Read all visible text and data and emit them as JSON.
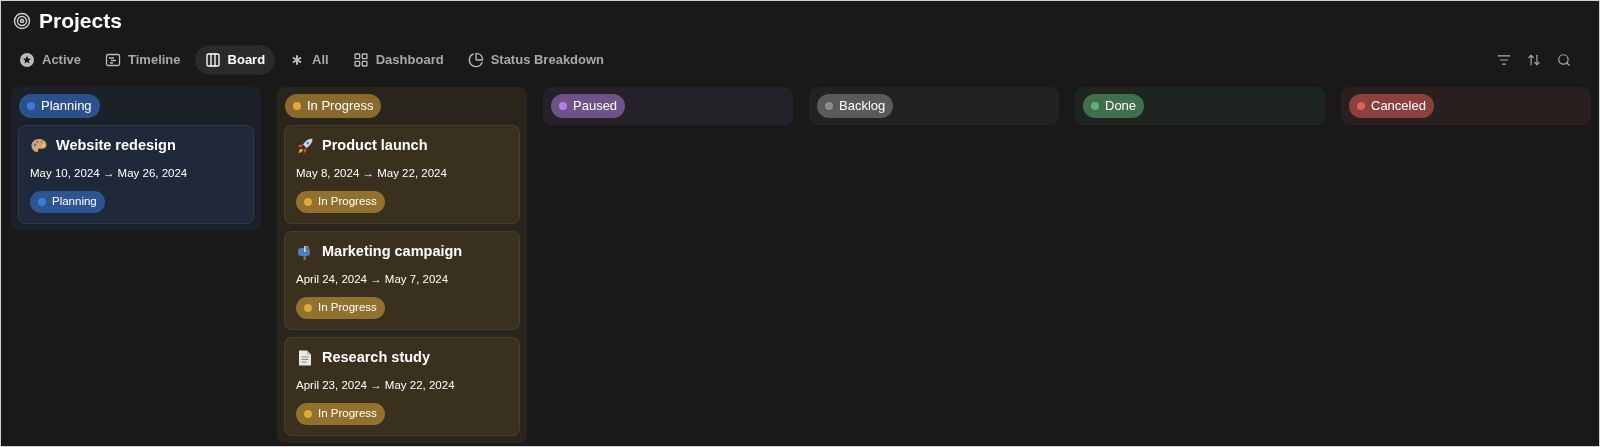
{
  "title": "Projects",
  "tabs": [
    {
      "label": "Active",
      "selected": false
    },
    {
      "label": "Timeline",
      "selected": false
    },
    {
      "label": "Board",
      "selected": true
    },
    {
      "label": "All",
      "selected": false
    },
    {
      "label": "Dashboard",
      "selected": false
    },
    {
      "label": "Status Breakdown",
      "selected": false
    }
  ],
  "columns": [
    {
      "status": "Planning",
      "color": "#3b7be0",
      "cards": [
        {
          "title": "Website redesign",
          "dates": "May 10, 2024 → May 26, 2024",
          "status": "Planning",
          "color": "#3b7be0"
        }
      ]
    },
    {
      "status": "In Progress",
      "color": "#e0a93a",
      "cards": [
        {
          "title": "Product launch",
          "dates": "May 8, 2024 → May 22, 2024",
          "status": "In Progress",
          "color": "#e0a93a"
        },
        {
          "title": "Marketing campaign",
          "dates": "April 24, 2024 → May 7, 2024",
          "status": "In Progress",
          "color": "#e0a93a"
        },
        {
          "title": "Research study",
          "dates": "April 23, 2024 → May 22, 2024",
          "status": "In Progress",
          "color": "#e0a93a"
        }
      ]
    },
    {
      "status": "Paused",
      "color": "#b07ee0"
    },
    {
      "status": "Backlog",
      "color": "#8c8c8c"
    },
    {
      "status": "Done",
      "color": "#5fb072"
    },
    {
      "status": "Canceled",
      "color": "#e0605a"
    }
  ]
}
